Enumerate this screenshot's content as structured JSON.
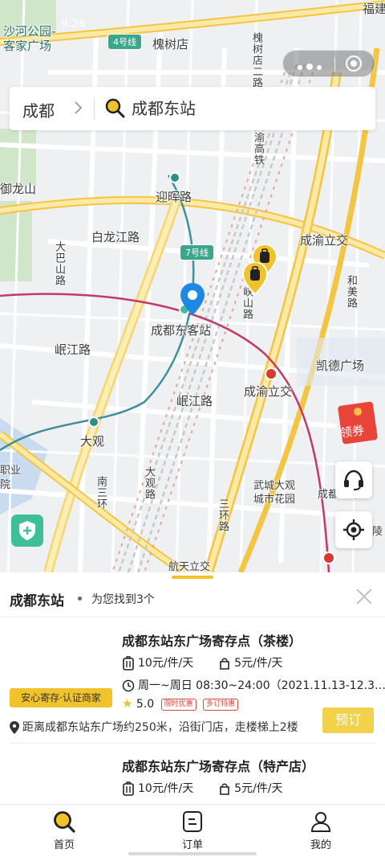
{
  "status_bar": {
    "time": "9:26"
  },
  "search": {
    "city": "成都",
    "query": "成都东站"
  },
  "map": {
    "labels": {
      "park": "沙河公园-\n客家广场",
      "huaishu": "槐树店",
      "fujian": "福建",
      "huaishu_road": "槐树店二路",
      "yulong": "御龙山",
      "yinghui": "迎晖路",
      "bailongjiang": "白龙江路",
      "chengyu_top": "成渝立交",
      "dabashan": "大巴山路",
      "station": "成都东客站",
      "minjiang": "岷江路",
      "kaide": "凯德广场",
      "chengyu_mid": "成渝立交",
      "minjiang2": "岷江路",
      "daguan": "大观",
      "wucheng": "武城大观\n城市花园",
      "chengdong": "成都东源",
      "sanhuan": "三环路",
      "hangtian": "航天立交",
      "hemei": "和美路",
      "zhiye": "职业",
      "line4": "4号线",
      "line7": "7号线",
      "xiasan": "峡山路",
      "chengjiang": "成渝高铁",
      "ling": "陵",
      "datong": "大观路",
      "ningjiang": "南三环",
      "yuan": "院"
    },
    "coupon_label": "领券"
  },
  "sheet": {
    "title": "成都东站",
    "count_text": "为您找到3个",
    "results": [
      {
        "name": "成都东站东广场寄存点（茶楼）",
        "price_large": "10元/件/天",
        "price_small": "5元/件/天",
        "hours": "周一~周日 08:30~24:00（2021.11.13-12.3…",
        "rating": "5.0",
        "badges": [
          "限时优惠",
          "多订特惠"
        ],
        "merchant_tag": "安心寄存·认证商家",
        "address": "距离成都东站东广场约250米，沿街门店，走楼梯上2楼",
        "book_label": "预订"
      },
      {
        "name": "成都东站东广场寄存点（特产店）",
        "price_large": "10元/件/天",
        "price_small": "5元/件/天"
      }
    ]
  },
  "tabs": [
    {
      "label": "首页",
      "icon": "search-icon",
      "active": true
    },
    {
      "label": "订单",
      "icon": "order-icon"
    },
    {
      "label": "我的",
      "icon": "user-icon"
    }
  ],
  "colors": {
    "accent": "#f0c22b",
    "book_button": "#f2d24a",
    "coupon": "#e8443a",
    "metro": "#2f8f87",
    "rail": "#d83a2c",
    "shield": "#3ebf9a"
  }
}
